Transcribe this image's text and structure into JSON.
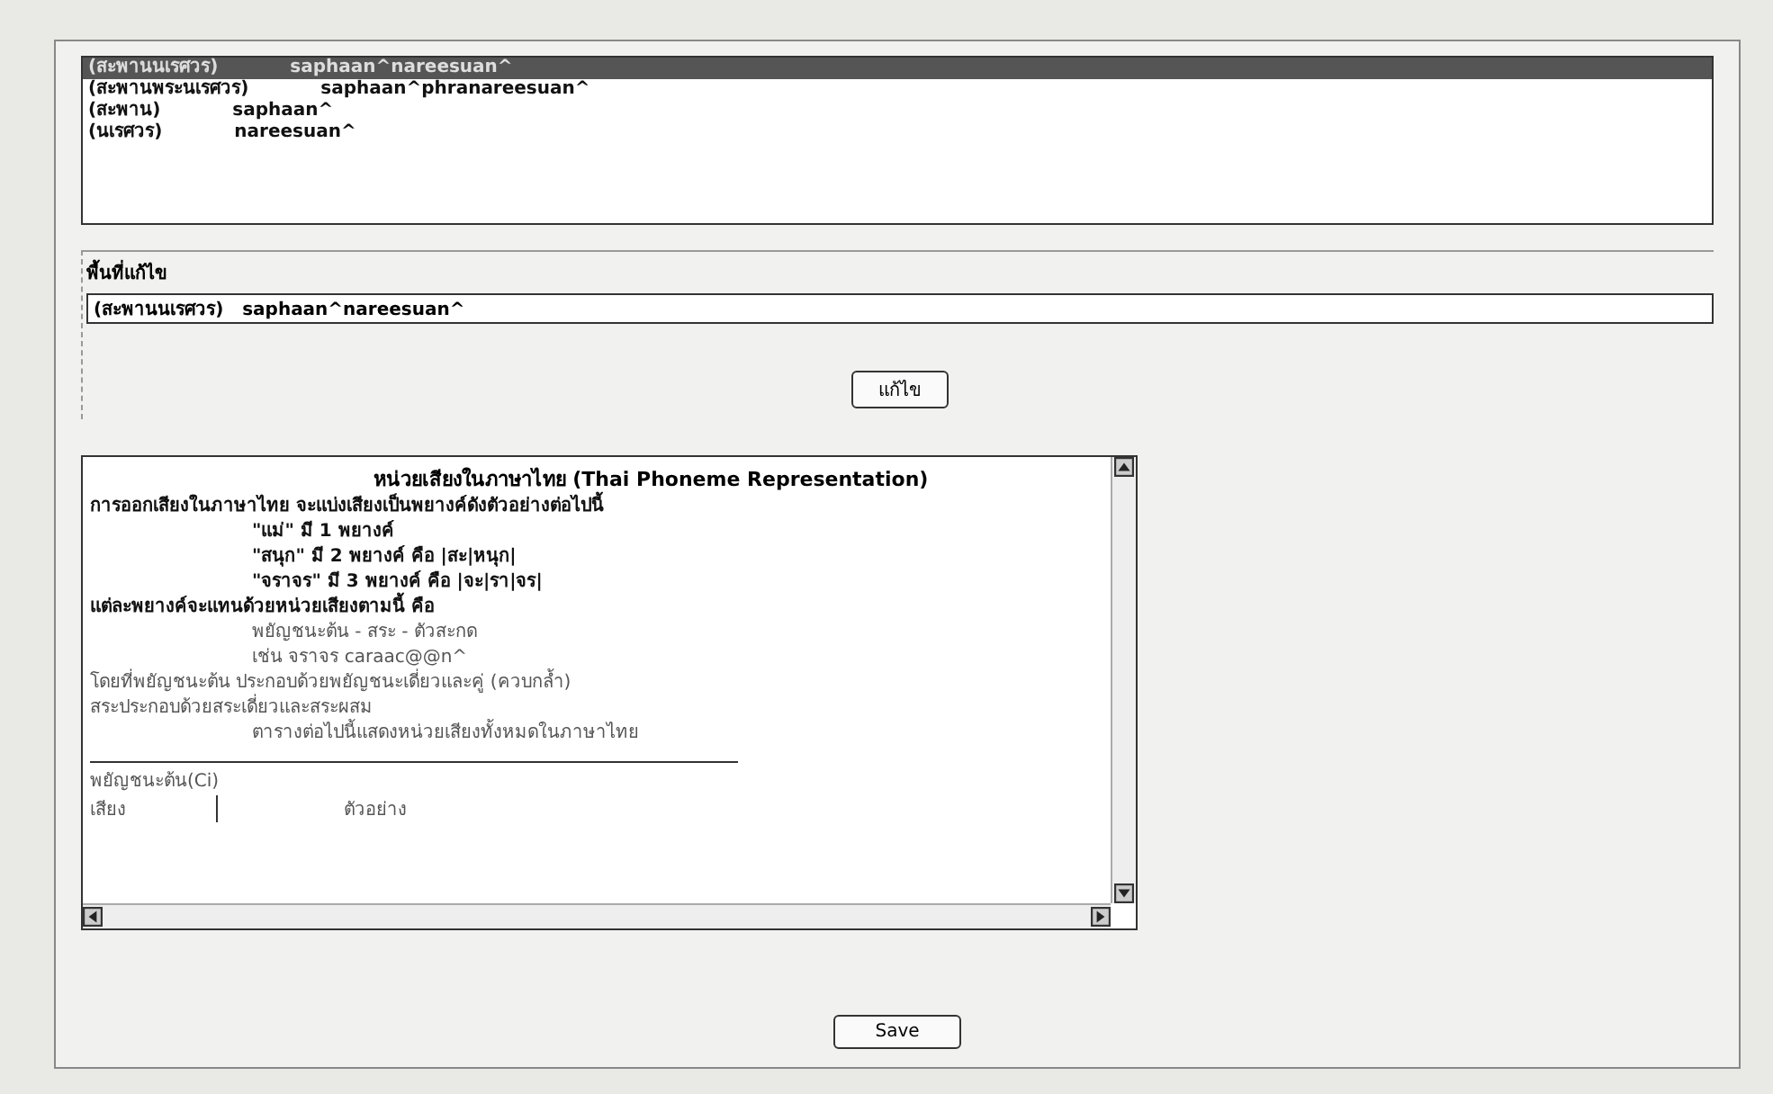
{
  "candidates": [
    {
      "thai": "(สะพานนเรศวร)",
      "phoneme": "saphaan^nareesuan^",
      "selected": true
    },
    {
      "thai": "(สะพานพระนเรศวร)",
      "phoneme": "saphaan^phranareesuan^",
      "selected": false
    },
    {
      "thai": "(สะพาน)",
      "phoneme": "saphaan^",
      "selected": false
    },
    {
      "thai": "(นเรศวร)",
      "phoneme": "nareesuan^",
      "selected": false
    }
  ],
  "edit_area": {
    "label": "พื้นที่แก้ไข",
    "value": "(สะพานนเรศวร)   saphaan^nareesuan^",
    "button": "แก้ไข"
  },
  "guide": {
    "title": "หน่วยเสียงในภาษาไทย (Thai Phoneme Representation)",
    "lines": [
      {
        "text": "การออกเสียงในภาษาไทย จะแบ่งเสียงเป็นพยางค์ดังตัวอย่างต่อไปนี้",
        "kind": "bold"
      },
      {
        "text": "\"แม่\" มี 1 พยางค์",
        "kind": "bold-indent"
      },
      {
        "text": "\"สนุก\" มี 2 พยางค์ คือ |สะ|หนุก|",
        "kind": "bold-indent"
      },
      {
        "text": "\"จราจร\" มี 3 พยางค์ คือ |จะ|รา|จร|",
        "kind": "bold-indent"
      },
      {
        "text": "แต่ละพยางค์จะแทนด้วยหน่วยเสียงตามนี้ คือ",
        "kind": "bold"
      },
      {
        "text": "พยัญชนะต้น - สระ - ตัวสะกด",
        "kind": "indent"
      },
      {
        "text": "เช่น จราจร   caraac@@n^",
        "kind": "indent"
      },
      {
        "text": "โดยที่พยัญชนะต้น ประกอบด้วยพยัญชนะเดี่ยวและคู่ (ควบกล้ำ)",
        "kind": "plain"
      },
      {
        "text": "สระประกอบด้วยสระเดี่ยวและสระผสม",
        "kind": "plain"
      },
      {
        "text": "ตารางต่อไปนี้แสดงหน่วยเสียงทั้งหมดในภาษาไทย",
        "kind": "indent"
      }
    ],
    "table_title": "พยัญชนะต้น(Ci)",
    "columns": [
      "เสียง",
      "ตัวอย่าง"
    ]
  },
  "save_button": "Save"
}
